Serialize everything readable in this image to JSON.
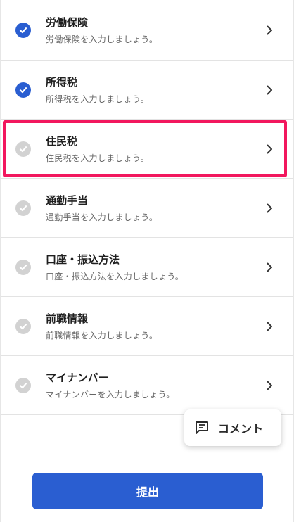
{
  "items": [
    {
      "title": "労働保険",
      "subtitle": "労働保険を入力しましょう。",
      "status": "done"
    },
    {
      "title": "所得税",
      "subtitle": "所得税を入力しましょう。",
      "status": "done"
    },
    {
      "title": "住民税",
      "subtitle": "住民税を入力しましょう。",
      "status": "todo",
      "highlighted": true
    },
    {
      "title": "通勤手当",
      "subtitle": "通勤手当を入力しましょう。",
      "status": "todo"
    },
    {
      "title": "口座・振込方法",
      "subtitle": "口座・振込方法を入力しましょう。",
      "status": "todo"
    },
    {
      "title": "前職情報",
      "subtitle": "前職情報を入力しましょう。",
      "status": "todo"
    },
    {
      "title": "マイナンバー",
      "subtitle": "マイナンバーを入力しましょう。",
      "status": "todo"
    }
  ],
  "comment_button": {
    "label": "コメント",
    "icon": "comment-icon"
  },
  "footer": {
    "submit_label": "提出"
  },
  "colors": {
    "accent": "#2a5ed1",
    "check_done": "#2a5ed1",
    "check_todo": "#d2d2d2",
    "highlight": "#f2175e"
  }
}
